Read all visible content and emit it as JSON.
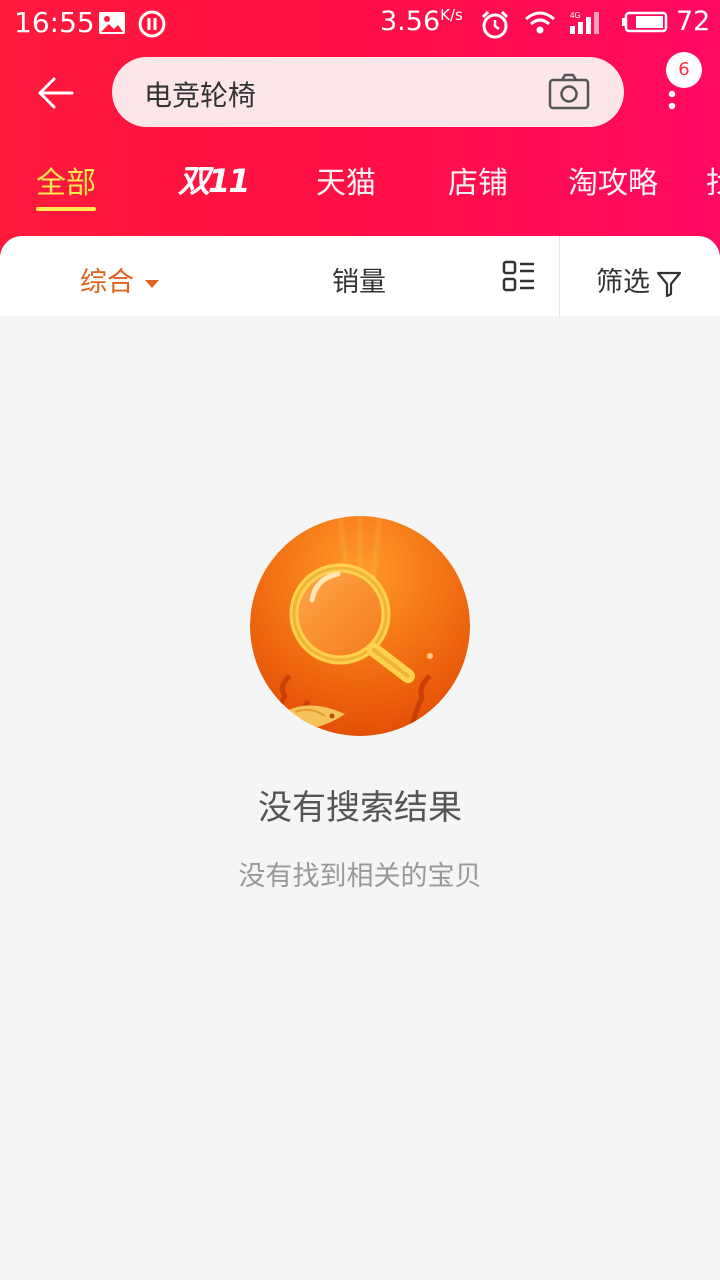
{
  "status_bar": {
    "time": "16:55",
    "speed": "3.56",
    "speed_unit": "K/s",
    "network": "4G",
    "battery": "72",
    "icons": [
      "image-icon",
      "pause-circle-icon",
      "alarm-icon",
      "wifi-icon",
      "signal-icon",
      "battery-icon"
    ]
  },
  "search": {
    "query": "电竞轮椅",
    "badge_count": "6"
  },
  "tabs": [
    {
      "label": "全部",
      "active": true
    },
    {
      "label": "双11",
      "active": false
    },
    {
      "label": "天猫",
      "active": false
    },
    {
      "label": "店铺",
      "active": false
    },
    {
      "label": "淘攻略",
      "active": false
    },
    {
      "label": "找",
      "active": false
    }
  ],
  "sort_bar": {
    "comprehensive": "综合",
    "sales": "销量",
    "filter": "筛选"
  },
  "empty_state": {
    "title": "没有搜索结果",
    "subtitle": "没有找到相关的宝贝"
  },
  "colors": {
    "header_start": "#ff1a3c",
    "header_end": "#ff0a62",
    "active_tab": "#ffe94d",
    "active_sort": "#e0631d"
  }
}
